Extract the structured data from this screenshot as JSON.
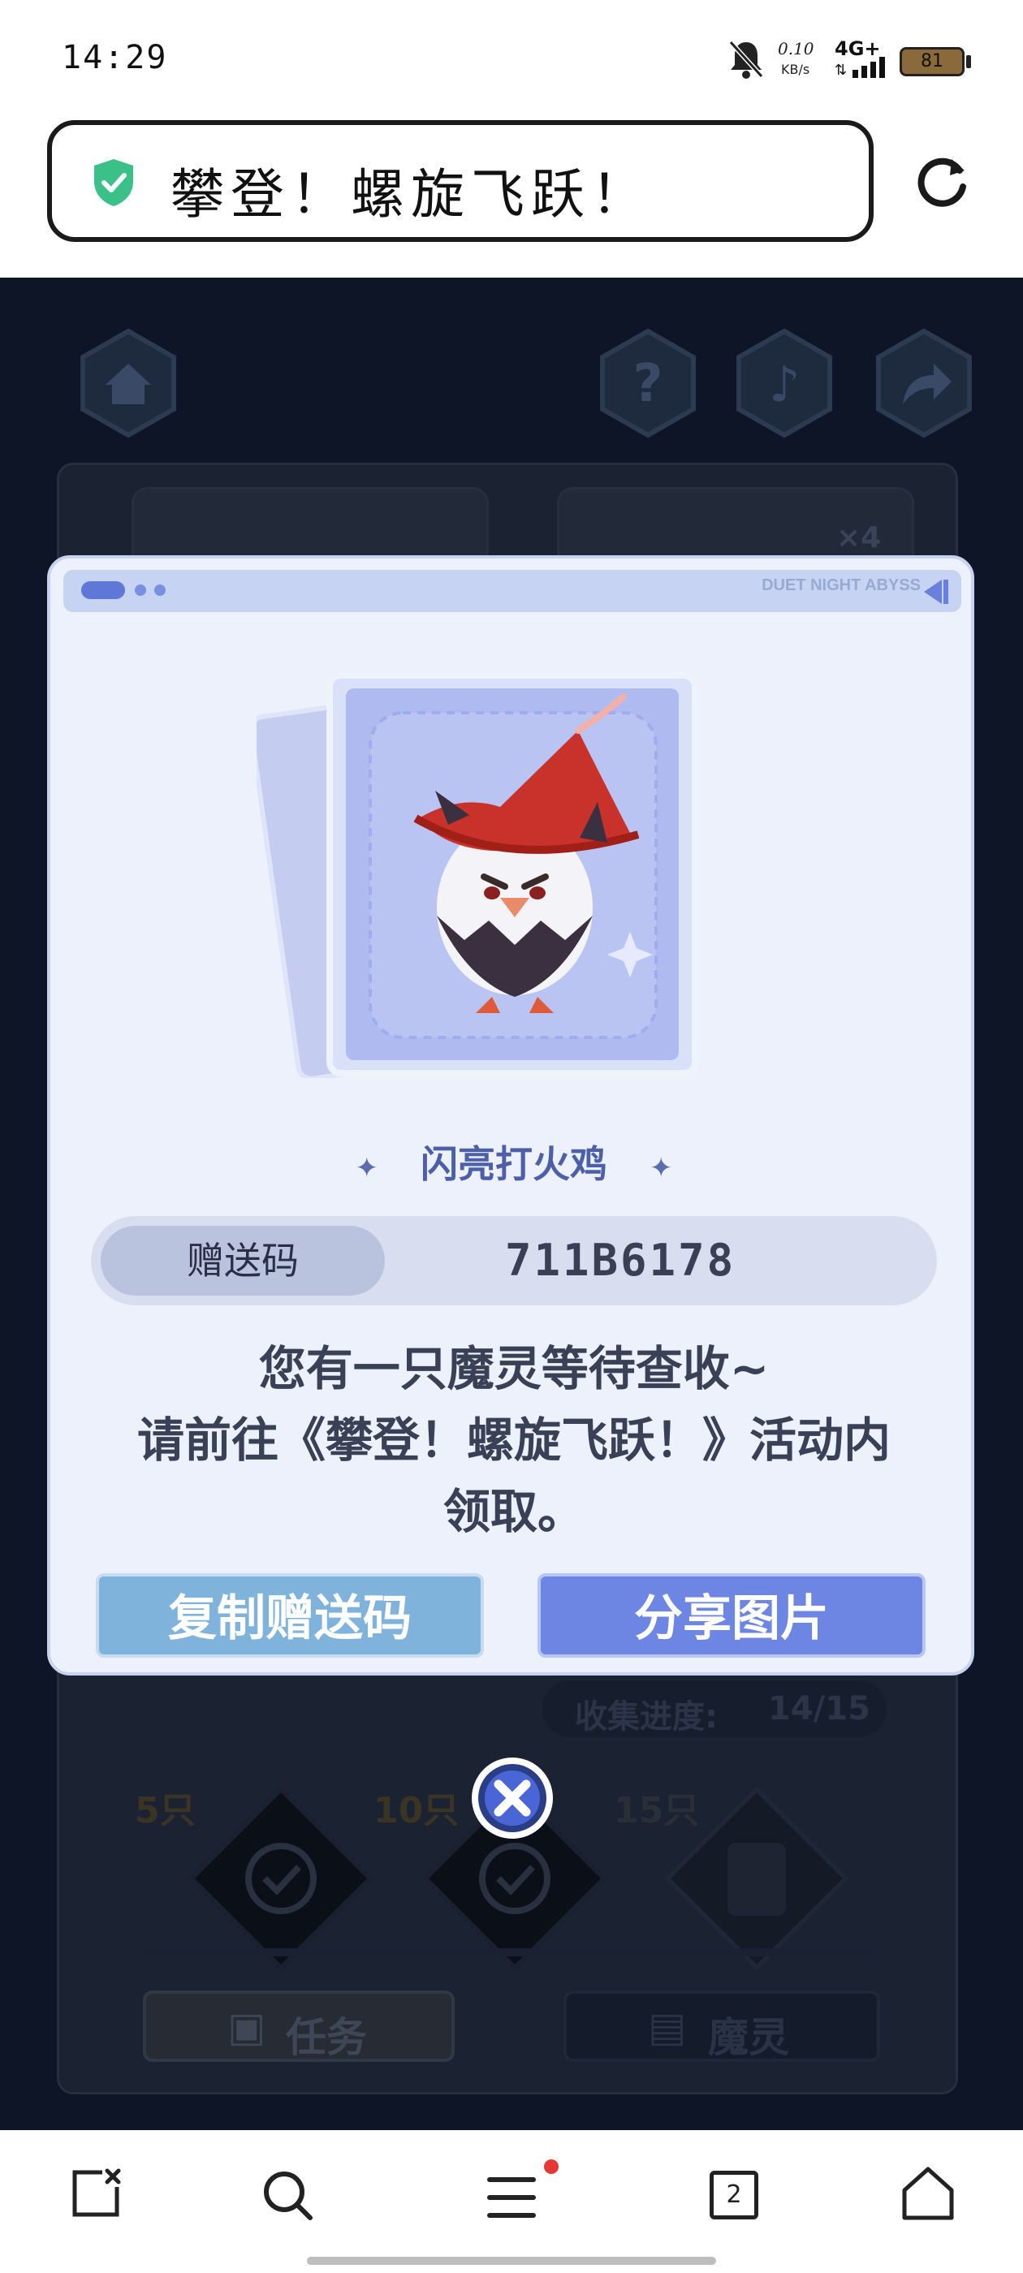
{
  "status_bar": {
    "time": "14:29",
    "net_speed_value": "0.10",
    "net_speed_unit": "KB/s",
    "network_type": "4G+",
    "battery_level": "81"
  },
  "address_bar": {
    "title": "攀登！螺旋飞跃！"
  },
  "background_game": {
    "progress_label": "收集进度:",
    "progress_value": "14/15",
    "multiplier": "×4",
    "milestones": [
      "5只",
      "10只",
      "15只"
    ],
    "tab_task": "任务",
    "tab_spirit": "魔灵"
  },
  "dialog": {
    "brand": "DUET NIGHT ABYSS",
    "pet_name": "闪亮打火鸡",
    "code_label": "赠送码",
    "code_value": "711B6178",
    "message_line1": "您有一只魔灵等待查收~",
    "message_line2": "请前往《攀登！螺旋飞跃！》活动内",
    "message_line3": "领取。",
    "copy_button": "复制赠送码",
    "share_button": "分享图片"
  },
  "nav_bar": {
    "tab_count": "2"
  },
  "colors": {
    "accent_blue": "#6e86e3",
    "copy_button_blue": "#7fb3dc",
    "shield_green": "#3cc08a",
    "notification_red": "#e53935"
  }
}
